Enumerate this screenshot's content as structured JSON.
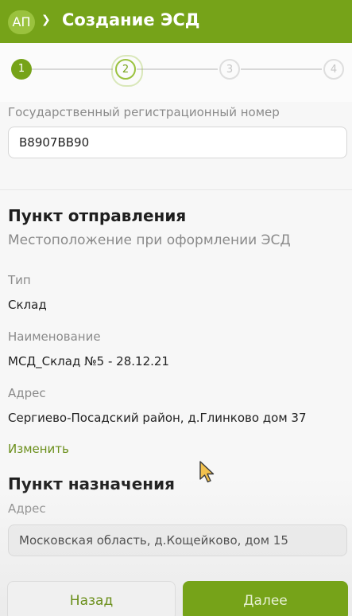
{
  "header": {
    "avatar": "АП",
    "title": "Создание ЭСД"
  },
  "stepper": {
    "steps": [
      "1",
      "2",
      "3",
      "4"
    ],
    "current": 2
  },
  "vehicle": {
    "label": "Государственный регистрационный номер",
    "value": "В8907ВВ90"
  },
  "departure": {
    "title": "Пункт отправления",
    "subtitle": "Местоположение при оформлении ЭСД",
    "type_label": "Тип",
    "type_value": "Склад",
    "name_label": "Наименование",
    "name_value": "МСД_Склад №5 - 28.12.21",
    "address_label": "Адрес",
    "address_value": "Сергиево-Посадский район, д.Глинково дом 37",
    "edit_link": "Изменить"
  },
  "destination": {
    "title": "Пункт назначения",
    "address_label": "Адрес",
    "address_value": "Московская область, д.Кощейково, дом 15"
  },
  "footer": {
    "back_label": "Назад",
    "next_label": "Далее"
  },
  "colors": {
    "primary": "#76a319",
    "light_primary": "#9ac23e",
    "link": "#6b8f1b"
  }
}
